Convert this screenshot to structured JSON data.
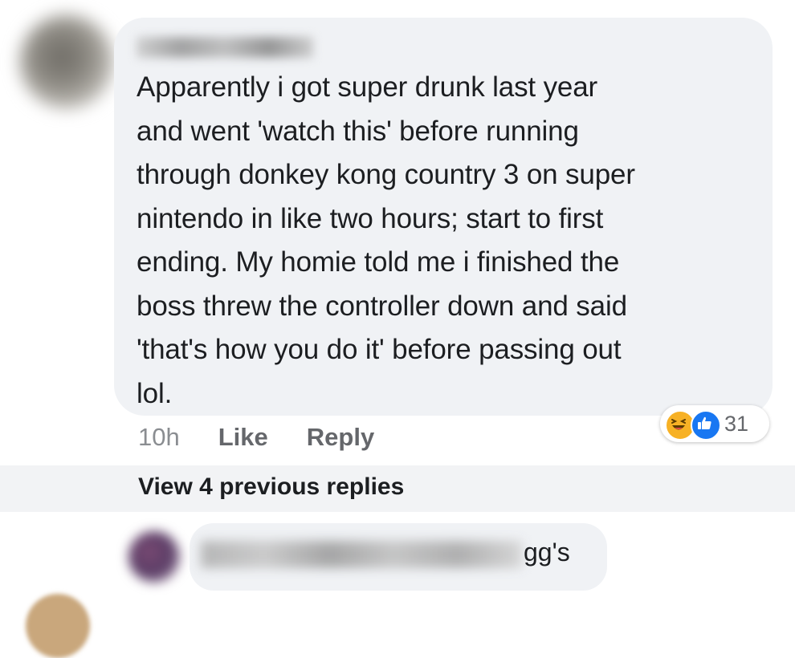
{
  "comment": {
    "text": "Apparently i got super drunk last year\nand went 'watch this' before running\nthrough donkey kong country 3 on super\nnintendo in like two hours; start to first\nending. My homie told me i finished the\nboss threw the controller down and said\n'that's how you do it' before passing out\nlol.",
    "timestamp": "10h",
    "like_label": "Like",
    "reply_label": "Reply",
    "reaction_count": "31",
    "reaction_icons": [
      "haha-icon",
      "like-icon"
    ]
  },
  "replies": {
    "view_previous_label": "View 4 previous replies",
    "preview_text_suffix": "gg's"
  },
  "colors": {
    "bubble_bg": "#f0f2f5",
    "meta_text": "#65676b",
    "like_blue": "#1877f2",
    "haha_yellow": "#f7b125"
  }
}
